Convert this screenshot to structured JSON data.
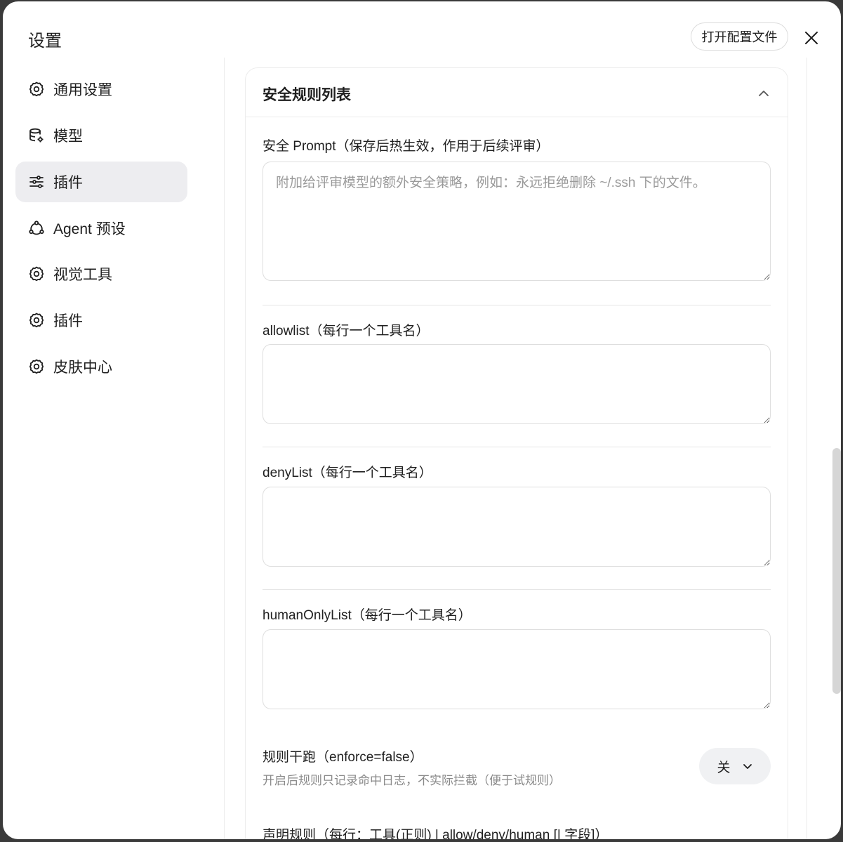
{
  "dialog": {
    "title": "设置",
    "open_config_label": "打开配置文件"
  },
  "sidebar": {
    "items": [
      {
        "label": "通用设置",
        "icon": "gear-icon"
      },
      {
        "label": "模型",
        "icon": "database-gear-icon"
      },
      {
        "label": "插件",
        "icon": "sliders-icon",
        "active": true
      },
      {
        "label": "Agent 预设",
        "icon": "agent-icon"
      },
      {
        "label": "视觉工具",
        "icon": "gear-icon"
      },
      {
        "label": "插件",
        "icon": "gear-icon"
      },
      {
        "label": "皮肤中心",
        "icon": "gear-icon"
      }
    ]
  },
  "card": {
    "title": "安全规则列表",
    "security_prompt": {
      "label": "安全 Prompt（保存后热生效，作用于后续评审）",
      "value": "",
      "placeholder": "附加给评审模型的额外安全策略，例如：永远拒绝删除 ~/.ssh 下的文件。"
    },
    "allowlist": {
      "label": "allowlist（每行一个工具名）",
      "value": ""
    },
    "denylist": {
      "label": "denyList（每行一个工具名）",
      "value": ""
    },
    "human_only": {
      "label": "humanOnlyList（每行一个工具名）",
      "value": ""
    },
    "dry_run": {
      "label": "规则干跑（enforce=false）",
      "description": "开启后规则只记录命中日志，不实际拦截（便于试规则）",
      "value": "关"
    },
    "declared_rules": {
      "label": "声明规则（每行：工具(正则) | allow/deny/human [| 字段]）"
    }
  }
}
